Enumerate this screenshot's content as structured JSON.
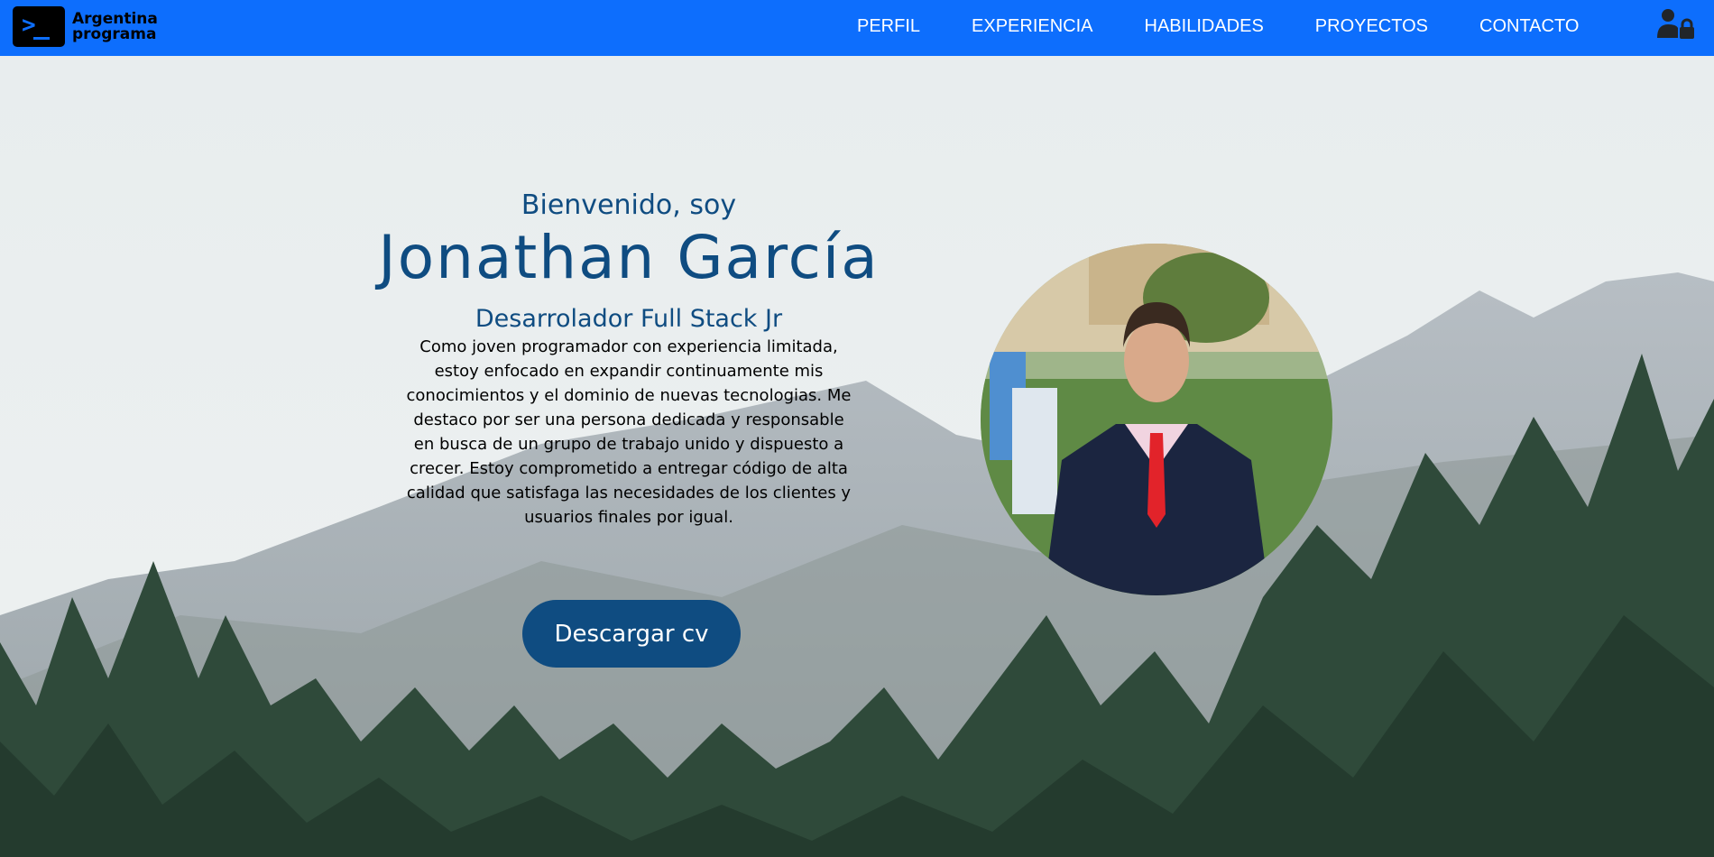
{
  "nav": {
    "logo_line1": "Argentina",
    "logo_line2": "programa",
    "links": [
      "PERFIL",
      "EXPERIENCIA",
      "HABILIDADES",
      "PROYECTOS",
      "CONTACTO"
    ],
    "login_icon": "user-lock-icon"
  },
  "hero": {
    "greeting": "Bienvenido, soy",
    "name": "Jonathan García",
    "role": "Desarrolador Full Stack Jr",
    "about": "Como joven programador con experiencia limitada, estoy enfocado en expandir continuamente mis conocimientos y el dominio de nuevas tecnologias. Me destaco por ser una persona dedicada y responsable en busca de un grupo de trabajo unido y dispuesto a crecer. Estoy comprometido a entregar código de alta calidad que satisfaga las necesidades de los clientes y usuarios finales por igual.",
    "cv_button": "Descargar cv"
  },
  "colors": {
    "navbar": "#0d6efd",
    "accent": "#0f4c81"
  }
}
